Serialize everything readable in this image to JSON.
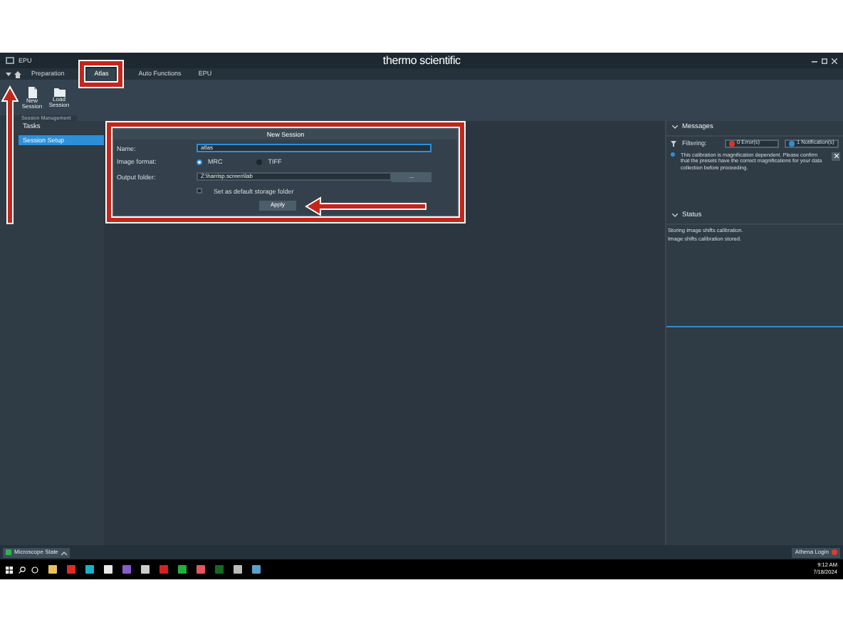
{
  "window": {
    "app": "EPU",
    "brand": "thermo scientific"
  },
  "tabs": [
    {
      "label": "Preparation",
      "selected": false
    },
    {
      "label": "Atlas",
      "selected": true
    },
    {
      "label": "Auto Functions",
      "selected": false
    },
    {
      "label": "EPU",
      "selected": false
    }
  ],
  "ribbon": {
    "buttons": [
      {
        "label": "New Session",
        "kind": "new"
      },
      {
        "label": "Load Session",
        "kind": "load"
      }
    ],
    "group": "Session Management"
  },
  "tasks": {
    "title": "Tasks",
    "items": [
      {
        "label": "Session Setup",
        "selected": true
      }
    ]
  },
  "dialog": {
    "title": "New Session",
    "name_label": "Name:",
    "name_value": "atlas",
    "format_label": "Image format:",
    "formats": [
      {
        "label": "MRC",
        "selected": true
      },
      {
        "label": "TIFF",
        "selected": false
      }
    ],
    "folder_label": "Output folder:",
    "folder_value": "Z:\\harrisp.screen\\lab",
    "browse": "...",
    "default_folder": {
      "label": "Set as default storage folder",
      "checked": false
    },
    "apply": "Apply"
  },
  "messages": {
    "title": "Messages",
    "filter_label": "Filtering:",
    "filters": [
      {
        "label": "0 Error(s)",
        "color": "#d9342b"
      },
      {
        "label": "1 Notification(s)",
        "color": "#2d8fd8"
      }
    ],
    "items": [
      {
        "text": "This calibration is magnification dependent. Please confirm that the presets have the correct magnifications for your data collection before proceeding."
      }
    ]
  },
  "status": {
    "title": "Status",
    "lines": [
      "Storing image shifts calibration.",
      "Image shifts calibration stored."
    ]
  },
  "status_bar": {
    "left": "Microscope State",
    "right": "Athena Login"
  },
  "taskbar": {
    "time": "9:12 AM",
    "date": "7/18/2024"
  },
  "annotations": [
    {
      "kind": "box"
    },
    {
      "kind": "box"
    },
    {
      "kind": "arrow_up"
    },
    {
      "kind": "arrow_left"
    }
  ]
}
